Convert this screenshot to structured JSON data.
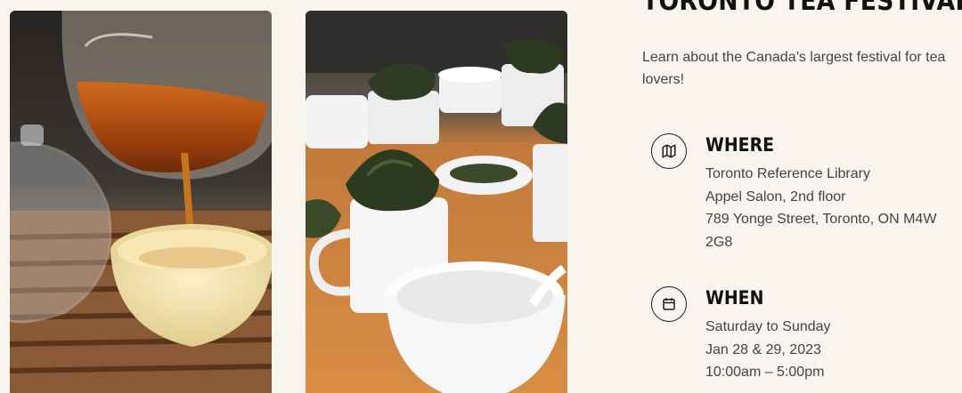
{
  "colors": {
    "background": "#f8f5ef",
    "text": "#444444",
    "heading": "#111111"
  },
  "photos": [
    {
      "alt": "Tea being poured from a glass pitcher into a cup"
    },
    {
      "alt": "Cups of loose tea leaves at a tasting table"
    }
  ],
  "event": {
    "title": "TORONTO TEA FESTIVAL",
    "description": "Learn about the Canada’s largest festival for tea lovers!",
    "where": {
      "icon": "map-icon",
      "heading": "WHERE",
      "lines": [
        "Toronto Reference Library",
        "Appel Salon, 2nd floor",
        "789 Yonge Street, Toronto, ON M4W 2G8"
      ]
    },
    "when": {
      "icon": "calendar-icon",
      "heading": "WHEN",
      "lines": [
        "Saturday to Sunday",
        "Jan 28 & 29, 2023",
        "10:00am – 5:00pm"
      ]
    }
  }
}
